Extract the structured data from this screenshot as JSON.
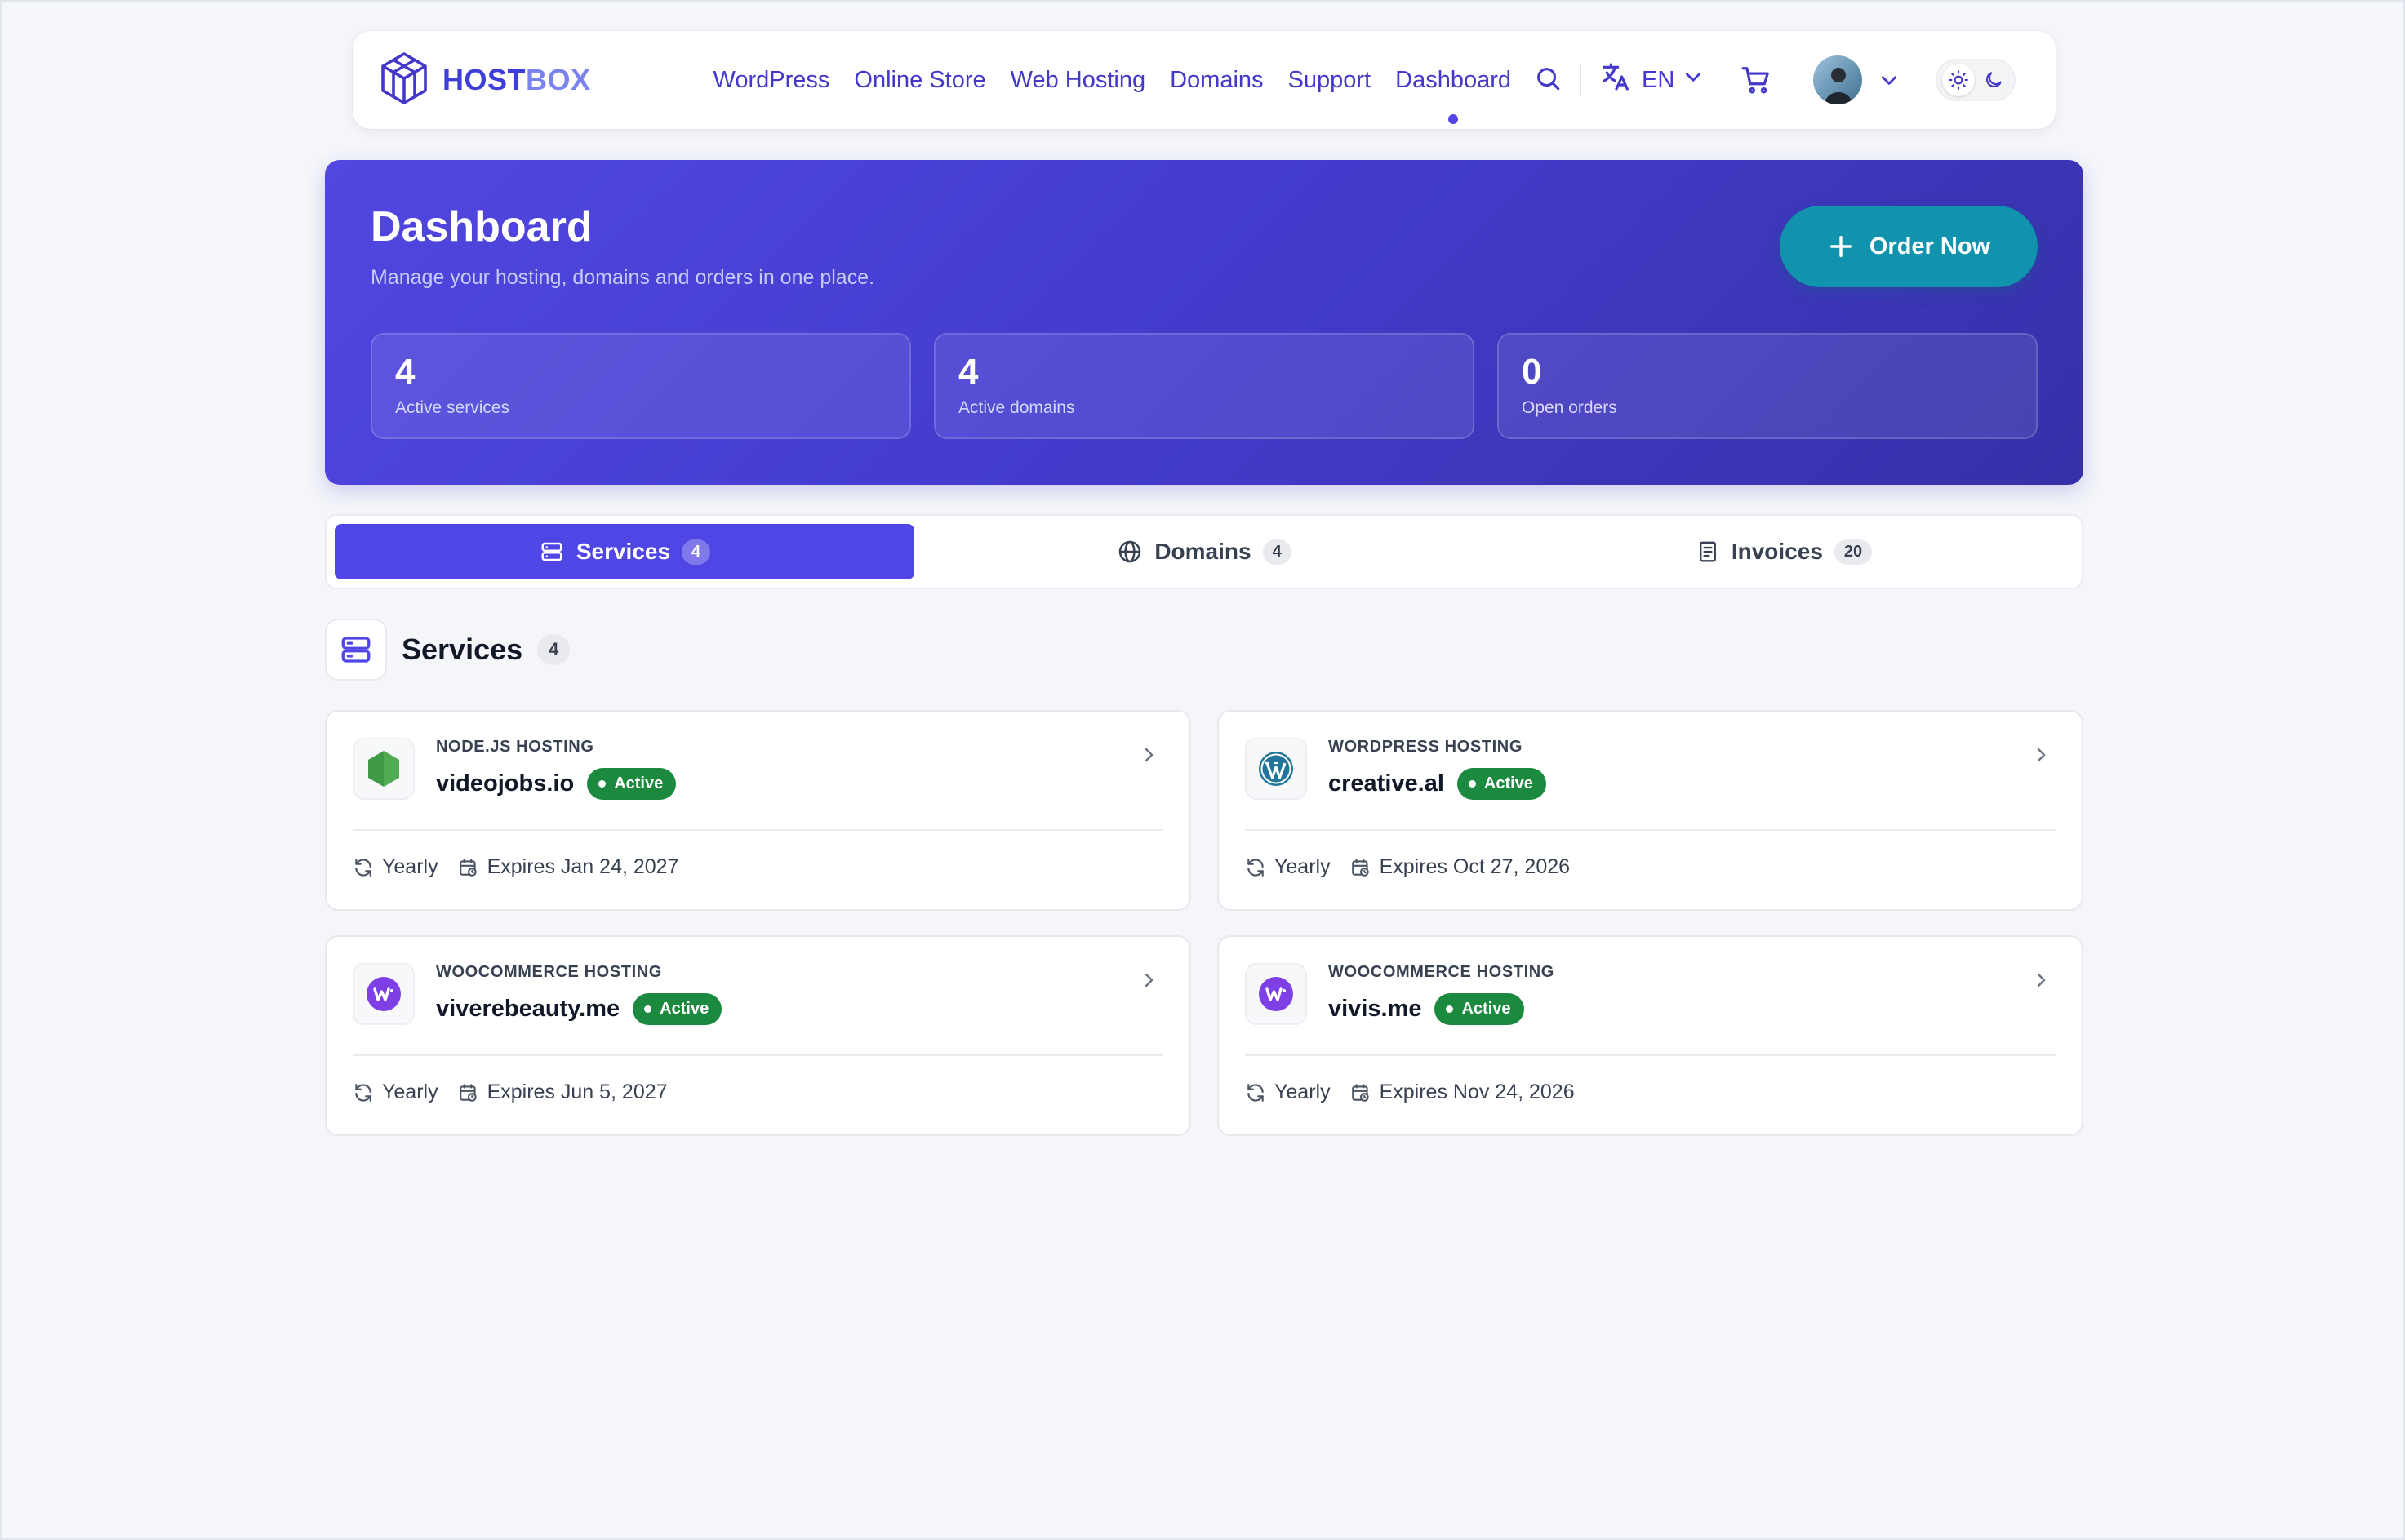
{
  "nav": {
    "brand_primary": "HOST",
    "brand_secondary": "BOX",
    "links": [
      "WordPress",
      "Online Store",
      "Web Hosting",
      "Domains",
      "Support",
      "Dashboard"
    ],
    "active_link": "Dashboard",
    "language": "EN"
  },
  "hero": {
    "title": "Dashboard",
    "subtitle": "Manage your hosting, domains and orders in one place.",
    "order_button": "Order Now",
    "stats": [
      {
        "value": "4",
        "label": "Active services"
      },
      {
        "value": "4",
        "label": "Active domains"
      },
      {
        "value": "0",
        "label": "Open orders"
      }
    ]
  },
  "tabs": [
    {
      "label": "Services",
      "count": "4",
      "icon": "server-icon",
      "active": true
    },
    {
      "label": "Domains",
      "count": "4",
      "icon": "globe-icon",
      "active": false
    },
    {
      "label": "Invoices",
      "count": "20",
      "icon": "document-icon",
      "active": false
    }
  ],
  "section": {
    "title": "Services",
    "count": "4"
  },
  "services": [
    {
      "type": "NODE.JS HOSTING",
      "name": "videojobs.io",
      "status": "Active",
      "billing": "Yearly",
      "expires": "Expires Jan 24, 2027",
      "logo": "nodejs-icon"
    },
    {
      "type": "WORDPRESS HOSTING",
      "name": "creative.al",
      "status": "Active",
      "billing": "Yearly",
      "expires": "Expires Oct 27, 2026",
      "logo": "wordpress-icon"
    },
    {
      "type": "WOOCOMMERCE HOSTING",
      "name": "viverebeauty.me",
      "status": "Active",
      "billing": "Yearly",
      "expires": "Expires Jun 5, 2027",
      "logo": "woocommerce-icon"
    },
    {
      "type": "WOOCOMMERCE HOSTING",
      "name": "vivis.me",
      "status": "Active",
      "billing": "Yearly",
      "expires": "Expires Nov 24, 2026",
      "logo": "woocommerce-icon"
    }
  ],
  "colors": {
    "accent": "#4f46e5",
    "order_button": "#1193ad",
    "active_badge": "#1b8a3e",
    "page_bg": "#f4f6fa"
  }
}
